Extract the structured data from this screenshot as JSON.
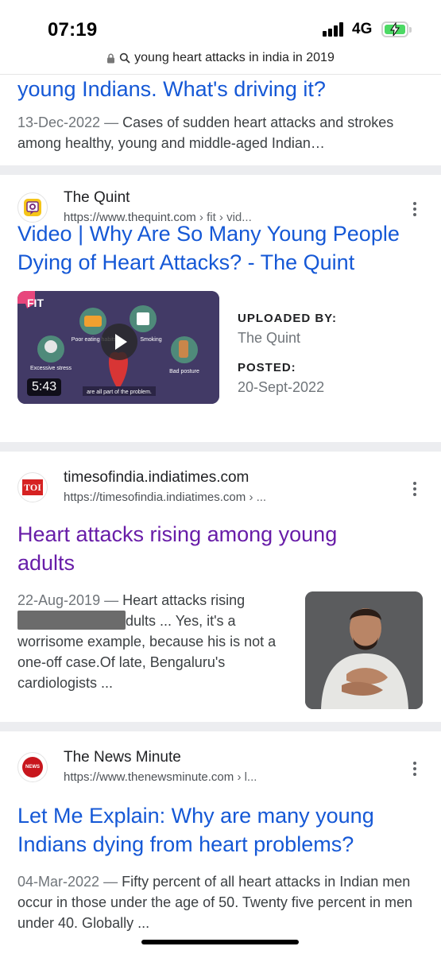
{
  "status_bar": {
    "time": "07:19",
    "network": "4G",
    "battery_state": "charging"
  },
  "url_bar": {
    "query": "young heart attacks in india in 2019",
    "lock_icon": "lock-icon",
    "search_icon": "search-icon"
  },
  "results": [
    {
      "title_tail": "young Indians. What's driving it?",
      "date": "13-Dec-2022",
      "snippet": "Cases of sudden heart attacks and strokes among healthy, young and middle-aged Indian…"
    },
    {
      "site_name": "The Quint",
      "url": "https://www.thequint.com",
      "breadcrumb": "› fit › vid...",
      "title": "Video | Why Are So Many Young People Dying of Heart Attacks? - The Quint",
      "video": {
        "duration": "5:43",
        "uploaded_by_label": "UPLOADED BY:",
        "uploaded_by": "The Quint",
        "posted_label": "POSTED:",
        "posted": "20-Sept-2022",
        "thumb_text": {
          "brand": "FIT",
          "poor_eating": "Poor eating habits",
          "smoking": "Smoking",
          "stress": "Excessive stress",
          "posture": "Bad posture",
          "caption": "are all part of the problem."
        }
      }
    },
    {
      "site_name": "timesofindia.indiatimes.com",
      "favicon_text": "TOI",
      "url": "https://timesofindia.indiatimes.com",
      "breadcrumb": "› ...",
      "title": "Heart attacks rising among young adults",
      "date": "22-Aug-2019",
      "snippet_a": "Heart attacks rising",
      "snippet_b": "dults ... Yes, it's a worrisome example, because his is not a one-off case.Of late, Bengaluru's cardiologists ..."
    },
    {
      "site_name": "The News Minute",
      "favicon_text": "NEWS",
      "url": "https://www.thenewsminute.com",
      "breadcrumb": "› l...",
      "title": "Let Me Explain: Why are many young Indians dying from heart problems?",
      "date": "04-Mar-2022",
      "snippet": "Fifty percent of all heart attacks in Indian men occur in those under the age of 50. Twenty five percent in men under 40. Globally ..."
    }
  ],
  "date_separator": " — ",
  "colors": {
    "link": "#1558d6",
    "visited": "#681da8",
    "separator": "#ecedf0",
    "battery": "#4cd964"
  }
}
